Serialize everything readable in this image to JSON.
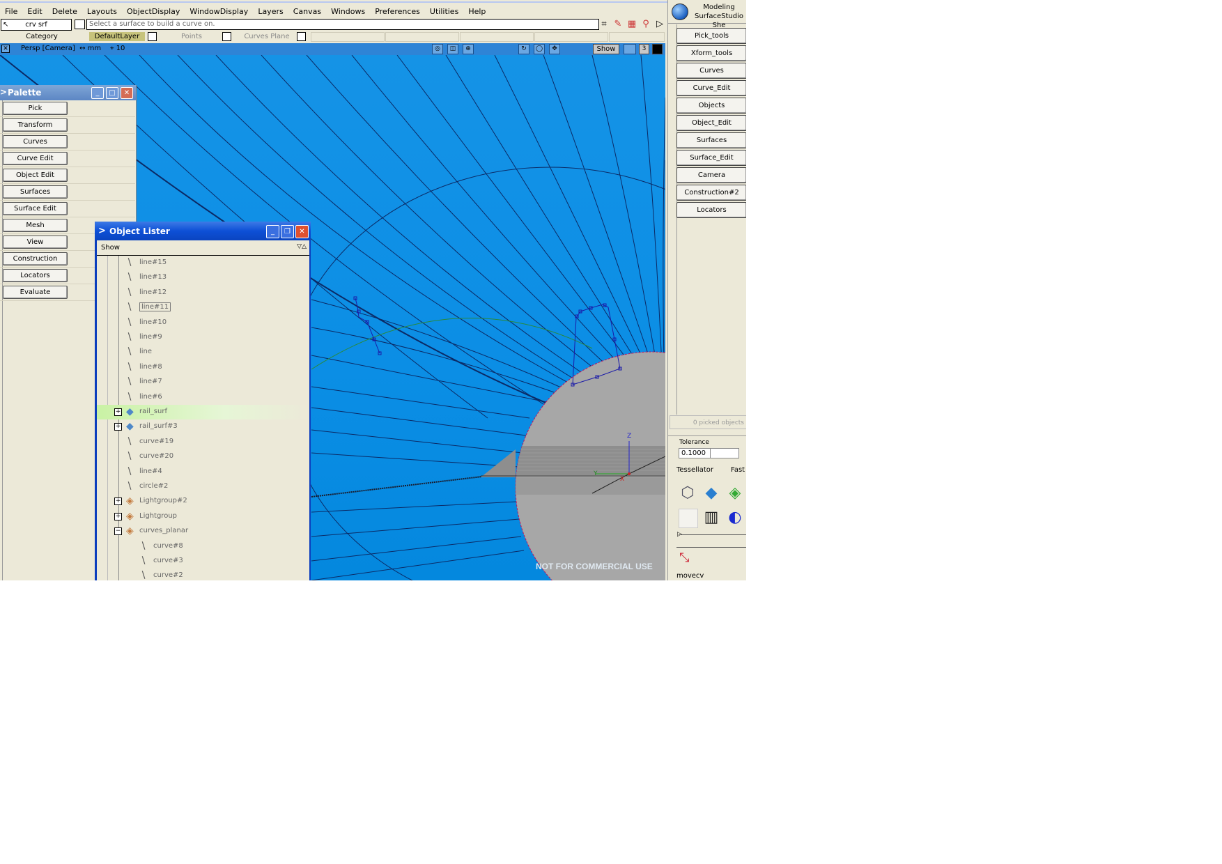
{
  "menubar": [
    "File",
    "Edit",
    "Delete",
    "Layouts",
    "ObjectDisplay",
    "WindowDisplay",
    "Layers",
    "Canvas",
    "Windows",
    "Preferences",
    "Utilities",
    "Help"
  ],
  "prompt": {
    "tool_name": "crv srf",
    "message": "Select a surface to build a curve on."
  },
  "layerbar": {
    "category": "Category",
    "layers": [
      "DefaultLayer",
      "Points",
      "Curves Plane"
    ]
  },
  "viewport": {
    "title": "Persp [Camera]",
    "units": "↔ mm",
    "grid": "10",
    "show_label": "Show",
    "count": "3",
    "watermark": "NOT FOR COMMERCIAL USE",
    "axis_labels": {
      "z": "Z",
      "y": "Y",
      "x": "X"
    }
  },
  "palette": {
    "title": "Palette",
    "items": [
      "Pick",
      "Transform",
      "Curves",
      "Curve Edit",
      "Object Edit",
      "Surfaces",
      "Surface Edit",
      "Mesh",
      "View",
      "Construction",
      "Locators",
      "Evaluate"
    ]
  },
  "lister": {
    "title": "Object Lister",
    "show_label": "Show",
    "rows": [
      {
        "name": "line#15",
        "type": "curve"
      },
      {
        "name": "line#13",
        "type": "curve"
      },
      {
        "name": "line#12",
        "type": "curve"
      },
      {
        "name": "line#11",
        "type": "curve",
        "boxed": true
      },
      {
        "name": "line#10",
        "type": "curve"
      },
      {
        "name": "line#9",
        "type": "curve"
      },
      {
        "name": "line",
        "type": "curve"
      },
      {
        "name": "line#8",
        "type": "curve"
      },
      {
        "name": "line#7",
        "type": "curve"
      },
      {
        "name": "line#6",
        "type": "curve"
      },
      {
        "name": "rail_surf",
        "type": "surface",
        "expander": "+",
        "highlight": true
      },
      {
        "name": "rail_surf#3",
        "type": "surface",
        "expander": "+"
      },
      {
        "name": "curve#19",
        "type": "curve"
      },
      {
        "name": "curve#20",
        "type": "curve"
      },
      {
        "name": "line#4",
        "type": "curve"
      },
      {
        "name": "circle#2",
        "type": "curve"
      },
      {
        "name": "Lightgroup#2",
        "type": "light",
        "expander": "+"
      },
      {
        "name": "Lightgroup",
        "type": "light",
        "expander": "+"
      },
      {
        "name": "curves_planar",
        "type": "light",
        "expander": "−"
      },
      {
        "name": "curve#8",
        "type": "curve",
        "child": true
      },
      {
        "name": "curve#3",
        "type": "curve",
        "child": true
      },
      {
        "name": "curve#2",
        "type": "curve",
        "child": true
      }
    ]
  },
  "shelf": {
    "mode": "Modeling",
    "shelf_name": "SurfaceStudio She",
    "tabs": [
      "Pick_tools",
      "Xform_tools",
      "Curves",
      "Curve_Edit",
      "Objects",
      "Object_Edit",
      "Surfaces",
      "Surface_Edit",
      "Camera",
      "Construction#2",
      "Locators"
    ],
    "picked": "0 picked objects",
    "tolerance_label": "Tolerance",
    "tolerance_value": "0.1000",
    "tessellator_label": "Tessellator",
    "tessellator_value": "Fast",
    "tool_label": "movecv"
  }
}
